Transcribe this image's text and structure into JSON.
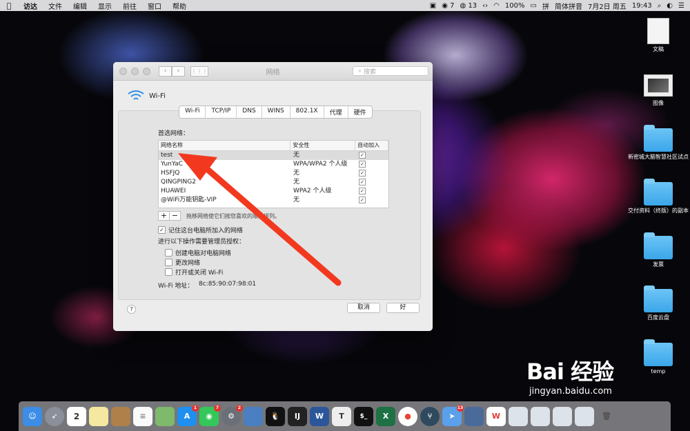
{
  "menubar": {
    "app_name": "访达",
    "items": [
      "文件",
      "编辑",
      "显示",
      "前往",
      "窗口",
      "帮助"
    ],
    "status": {
      "wechat_count": "7",
      "qq_count": "13",
      "battery": "100%",
      "input_method": "简体拼音",
      "date": "7月2日 周五",
      "time": "19:43"
    }
  },
  "desktop_icons": [
    {
      "label": "文稿",
      "type": "doc"
    },
    {
      "label": "图像",
      "type": "pic"
    },
    {
      "label": "新密城大脑智慧社区试点",
      "type": "folder"
    },
    {
      "label": "交付资料（终版）的副本",
      "type": "folder"
    },
    {
      "label": "发票",
      "type": "folder"
    },
    {
      "label": "百度云盘",
      "type": "folder"
    },
    {
      "label": "temp",
      "type": "folder"
    }
  ],
  "window": {
    "title": "网络",
    "search_placeholder": "搜索",
    "interface_name": "Wi-Fi",
    "tabs": [
      "Wi-Fi",
      "TCP/IP",
      "DNS",
      "WINS",
      "802.1X",
      "代理",
      "硬件"
    ],
    "active_tab": "Wi-Fi",
    "preferred_label": "首选网络：",
    "columns": [
      "网络名称",
      "安全性",
      "自动加入"
    ],
    "networks": [
      {
        "name": "test",
        "security": "无",
        "auto": "✓"
      },
      {
        "name": "YunYaC",
        "security": "WPA/WPA2 个人级",
        "auto": "✓"
      },
      {
        "name": "HSFJQ",
        "security": "无",
        "auto": "✓"
      },
      {
        "name": "QINGPING2",
        "security": "无",
        "auto": "✓"
      },
      {
        "name": "HUAWEI",
        "security": "WPA2 个人级",
        "auto": "✓"
      },
      {
        "name": "@WiFi万能钥匙-VIP",
        "security": "无",
        "auto": "✓"
      }
    ],
    "add_label": "+",
    "remove_label": "−",
    "drag_hint": "拖移网络使它们按您喜欢的顺序排列。",
    "remember_label": "记住这台电脑所加入的网络",
    "remember_checked": "✓",
    "admin_label": "进行以下操作需要管理员授权：",
    "admin_options": [
      "创建电脑对电脑网络",
      "更改网络",
      "打开或关闭 Wi-Fi"
    ],
    "wifi_address_label": "Wi-Fi 地址：",
    "wifi_address": "8c:85:90:07:98:01",
    "help_label": "?",
    "cancel_label": "取消",
    "ok_label": "好"
  },
  "dock": {
    "badges": {
      "appstore": "1",
      "wechat": "7",
      "prefs": "2",
      "qq": "13"
    }
  },
  "watermark": {
    "brand": "Bai 经验",
    "url": "jingyan.baidu.com"
  },
  "colors": {
    "arrow": "#f2391f",
    "wifi_icon": "#2b8fe6",
    "folder": "#4fb3ef"
  }
}
